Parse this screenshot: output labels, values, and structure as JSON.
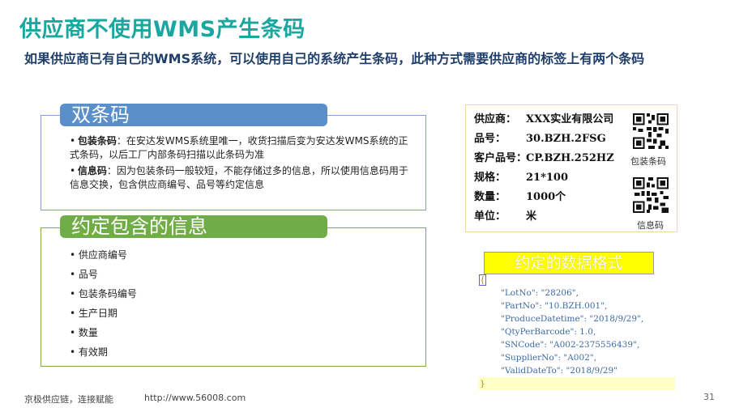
{
  "title": "供应商不使用WMS产生条码",
  "subtitle": "如果供应商已有自己的WMS系统，可以使用自己的系统产生条码，此种方式需要供应商的标签上有两个条码",
  "section1": {
    "header": "双条码",
    "items": [
      {
        "bullet": "•",
        "term": "包装条码",
        "text": "：在安达发WMS系统里唯一，收货扫描后变为安达发WMS系统的正式条码，以后工厂内部条码扫描以此条码为准"
      },
      {
        "bullet": "•",
        "term": "信息码",
        "text": "：因为包装条码一般较短，不能存储过多的信息，所以使用信息码用于信息交换，包含供应商编号、品号等约定信息"
      }
    ]
  },
  "section2": {
    "header": "约定包含的信息",
    "items": [
      "供应商编号",
      "品号",
      "包装条码编号",
      "生产日期",
      "数量",
      "有效期"
    ]
  },
  "label": {
    "rows": [
      {
        "key": "供应商：",
        "value": "XXX实业有限公司"
      },
      {
        "key": "品号：",
        "value": "30.BZH.2FSG"
      },
      {
        "key": "客户品号：",
        "value": "CP.BZH.252HZ"
      },
      {
        "key": "规格：",
        "value": "21*100"
      },
      {
        "key": "数量：",
        "value": "1000个"
      },
      {
        "key": "单位：",
        "value": "米"
      }
    ],
    "qr1_caption": "包装条码",
    "qr2_caption": "信息码"
  },
  "format": {
    "title": "约定的数据格式",
    "open": "{",
    "lines": [
      "\"LotNo\": \"28206\",",
      "\"PartNo\": \"10.BZH.001\",",
      "\"ProduceDatetime\": \"2018/9/29\",",
      "\"QtyPerBarcode\": 1.0,",
      "\"SNCode\": \"A002-2375556439\",",
      "\"SupplierNo\": \"A002\",",
      "\"ValidDateTo\": \"2018/9/29\""
    ],
    "close": "}"
  },
  "footer": {
    "left": "京极供应链，连接赋能",
    "url": "http://www.56008.com",
    "page": "31"
  },
  "colors": {
    "title": "#1aa7a0",
    "subtitle": "#1f3f6b",
    "pill_blue": "#5b8fc9",
    "pill_green": "#70ad47",
    "json_highlight": "#ffffc8",
    "format_title_bg": "#ffff00"
  }
}
